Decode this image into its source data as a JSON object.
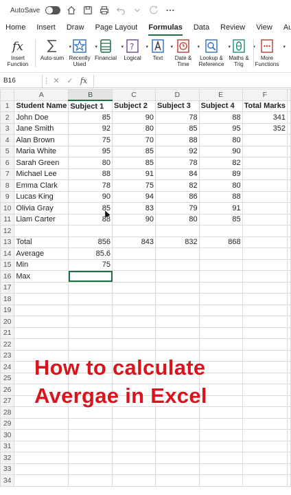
{
  "titlebar": {
    "autosave_label": "AutoSave"
  },
  "tabs": [
    "Home",
    "Insert",
    "Draw",
    "Page Layout",
    "Formulas",
    "Data",
    "Review",
    "View",
    "Au"
  ],
  "active_tab": "Formulas",
  "ribbon": {
    "buttons": [
      {
        "label": "Insert Function",
        "icon": "fx-icon"
      },
      {
        "label": "Auto-sum",
        "icon": "sigma-icon"
      },
      {
        "label": "Recently Used",
        "icon": "star-icon"
      },
      {
        "label": "Financial",
        "icon": "database-icon"
      },
      {
        "label": "Logical",
        "icon": "question-icon"
      },
      {
        "label": "Text",
        "icon": "text-a-icon"
      },
      {
        "label": "Date & Time",
        "icon": "clock-icon"
      },
      {
        "label": "Lookup & Reference",
        "icon": "search-icon"
      },
      {
        "label": "Maths & Trig",
        "icon": "theta-icon"
      },
      {
        "label": "More Functions",
        "icon": "more-icon"
      }
    ]
  },
  "formula_bar": {
    "name_box": "B16",
    "fx_label": "fx",
    "formula": ""
  },
  "grid": {
    "columns": [
      "A",
      "B",
      "C",
      "D",
      "E",
      "F"
    ],
    "rows": [
      [
        "Student Name",
        "Subject 1",
        "Subject 2",
        "Subject 3",
        "Subject 4",
        "Total Marks"
      ],
      [
        "John Doe",
        "85",
        "90",
        "78",
        "88",
        "341"
      ],
      [
        "Jane Smith",
        "92",
        "80",
        "85",
        "95",
        "352"
      ],
      [
        "Alan Brown",
        "75",
        "70",
        "88",
        "80",
        ""
      ],
      [
        "Maria White",
        "95",
        "85",
        "92",
        "90",
        ""
      ],
      [
        "Sarah Green",
        "80",
        "85",
        "78",
        "82",
        ""
      ],
      [
        "Michael Lee",
        "88",
        "91",
        "84",
        "89",
        ""
      ],
      [
        "Emma Clark",
        "78",
        "75",
        "82",
        "80",
        ""
      ],
      [
        "Lucas King",
        "90",
        "94",
        "86",
        "88",
        ""
      ],
      [
        "Olivia Gray",
        "85",
        "83",
        "79",
        "91",
        ""
      ],
      [
        "Liam Carter",
        "88",
        "90",
        "80",
        "85",
        ""
      ],
      [
        "",
        "",
        "",
        "",
        "",
        ""
      ],
      [
        "Total",
        "856",
        "843",
        "832",
        "868",
        ""
      ],
      [
        "Average",
        "85.6",
        "",
        "",
        "",
        ""
      ],
      [
        "Min",
        "75",
        "",
        "",
        "",
        ""
      ],
      [
        "Max",
        "",
        "",
        "",
        "",
        ""
      ]
    ],
    "total_rows": 34,
    "selected_cell": "B16"
  },
  "overlay": {
    "line1": "How to calculate",
    "line2": "Avergae in Excel",
    "color": "#d9141d"
  }
}
